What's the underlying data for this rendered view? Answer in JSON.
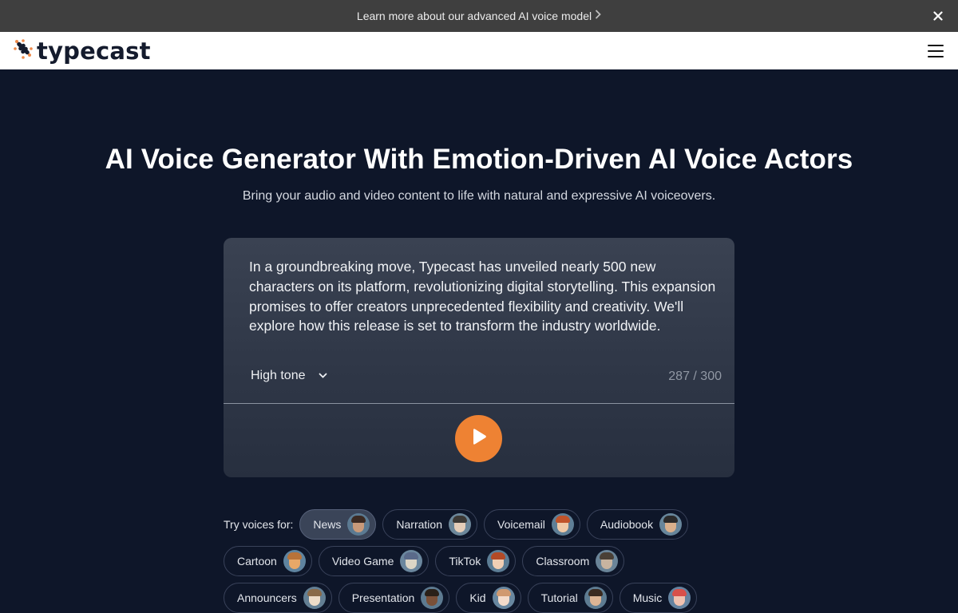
{
  "announcement": {
    "text": "Learn more about our advanced AI voice model",
    "chevron_icon": "chevron-right-icon",
    "close_icon": "close-icon"
  },
  "nav": {
    "logo_text": "typecast",
    "menu_icon": "hamburger-menu-icon"
  },
  "hero": {
    "title": "AI Voice Generator With Emotion-Driven AI Voice Actors",
    "subtitle": "Bring your audio and video content to life with natural and expressive AI voiceovers."
  },
  "editor": {
    "text": "In a groundbreaking move, Typecast has unveiled nearly 500 new characters on its platform, revolutionizing digital storytelling. This expansion promises to offer creators unprecedented flexibility and creativity. We'll explore how this release is set to transform the industry worldwide.",
    "tone": "High tone",
    "char_count": "287 / 300",
    "play_icon": "play-icon",
    "accent_color": "#ee8233"
  },
  "voices": {
    "label": "Try voices for:",
    "items": [
      {
        "label": "News",
        "active": true,
        "hair": "#3b2a22",
        "skin": "#c89a7a",
        "bg": "#5b7a92"
      },
      {
        "label": "Narration",
        "active": false,
        "hair": "#3d3a36",
        "skin": "#e5cdb8",
        "bg": "#6c879a"
      },
      {
        "label": "Voicemail",
        "active": false,
        "hair": "#c0532a",
        "skin": "#f0c9a6",
        "bg": "#5f7f96"
      },
      {
        "label": "Audiobook",
        "active": false,
        "hair": "#2b2b2b",
        "skin": "#d9b08c",
        "bg": "#67869b"
      },
      {
        "label": "Cartoon",
        "active": false,
        "hair": "#b8733a",
        "skin": "#e8a868",
        "bg": "#5f84a0"
      },
      {
        "label": "Video Game",
        "active": false,
        "hair": "#5a6a8a",
        "skin": "#dcd6c6",
        "bg": "#6b879e"
      },
      {
        "label": "TikTok",
        "active": false,
        "hair": "#b24a26",
        "skin": "#f1cfb4",
        "bg": "#5c7d95"
      },
      {
        "label": "Classroom",
        "active": false,
        "hair": "#4a4036",
        "skin": "#c8b4a0",
        "bg": "#6a8498"
      },
      {
        "label": "Announcers",
        "active": false,
        "hair": "#8a6a48",
        "skin": "#eedcc8",
        "bg": "#637f94"
      },
      {
        "label": "Presentation",
        "active": false,
        "hair": "#2a2018",
        "skin": "#7a5038",
        "bg": "#5d7a90"
      },
      {
        "label": "Kid",
        "active": false,
        "hair": "#d09a70",
        "skin": "#f4dccb",
        "bg": "#6887a0"
      },
      {
        "label": "Tutorial",
        "active": false,
        "hair": "#3a2a20",
        "skin": "#dcb494",
        "bg": "#5e7c92"
      },
      {
        "label": "Music",
        "active": false,
        "hair": "#d8504a",
        "skin": "#f0c2b0",
        "bg": "#6483a0"
      }
    ]
  }
}
